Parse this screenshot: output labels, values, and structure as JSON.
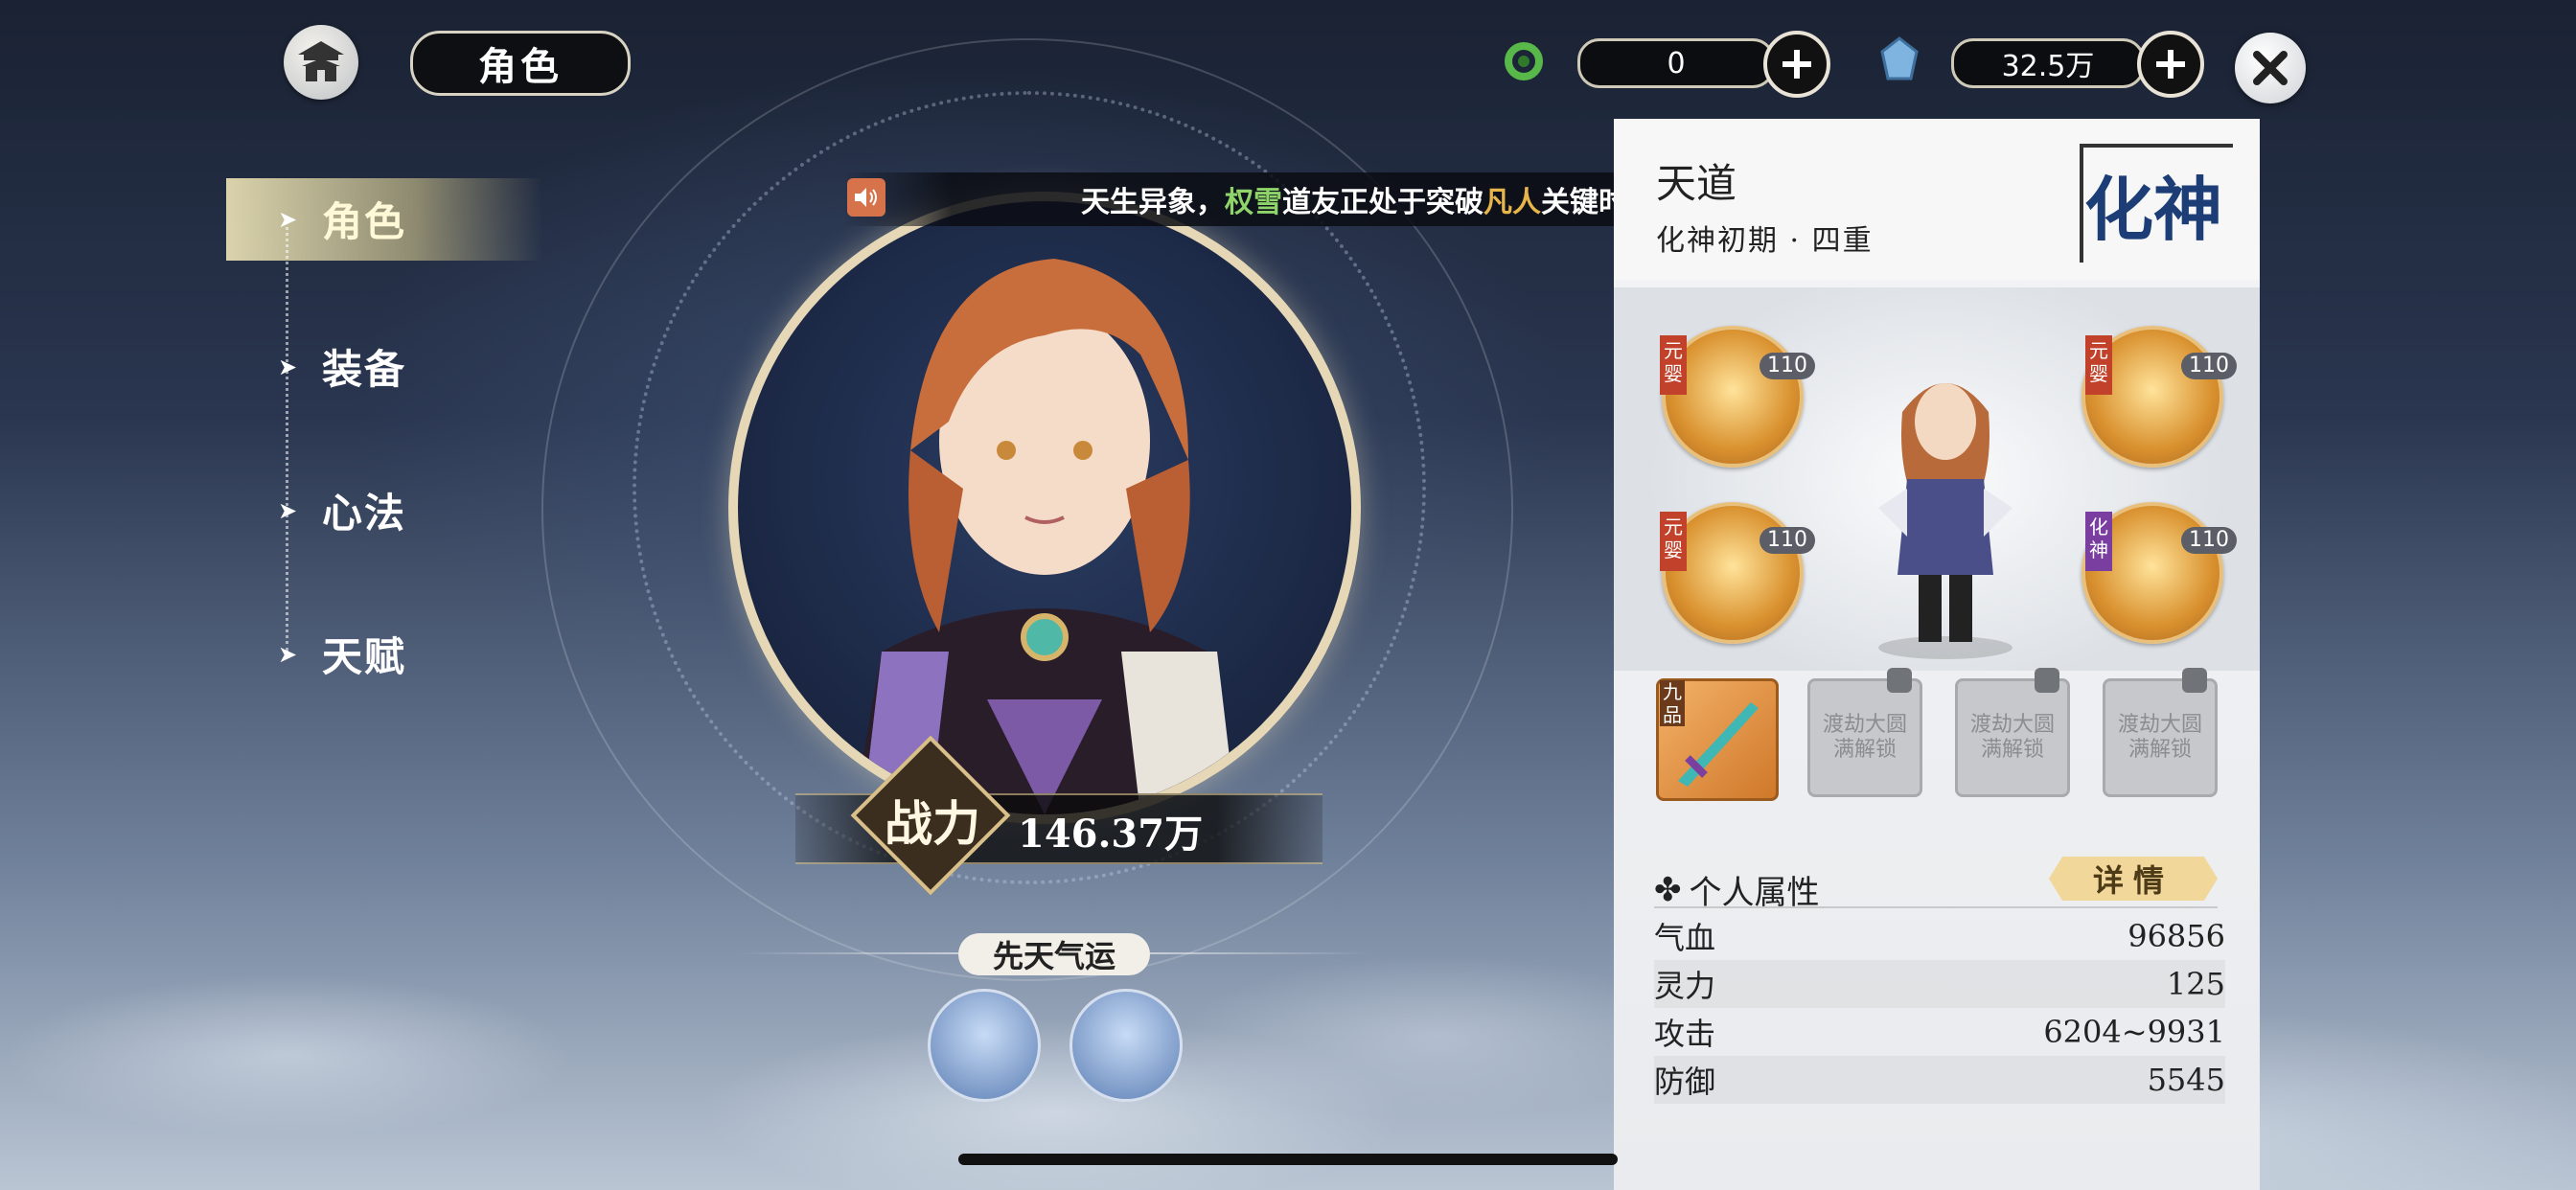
{
  "topbar": {
    "title": "角色",
    "currency1": {
      "icon": "jade-ring-icon",
      "value": "0"
    },
    "currency2": {
      "icon": "spirit-crystal-icon",
      "value": "32.5万"
    }
  },
  "nav": {
    "items": [
      {
        "label": "角色",
        "active": true
      },
      {
        "label": "装备",
        "active": false
      },
      {
        "label": "心法",
        "active": false
      },
      {
        "label": "天赋",
        "active": false
      }
    ]
  },
  "announcement": {
    "prefix": "天生异象，",
    "name": "权雪",
    "middle": "道友正处于突破",
    "realm": "凡人",
    "suffix": "关键时",
    "name_color": "#8fd46b",
    "realm_color": "#e7b54a"
  },
  "power": {
    "label": "战力",
    "value": "146.37万"
  },
  "fate": {
    "label": "先天气运"
  },
  "panel": {
    "realm_name": "天道",
    "realm_sub": "化神初期 · 四重",
    "realm_seal": "化神",
    "books": [
      {
        "tag": "元婴",
        "level": "110"
      },
      {
        "tag": "元婴",
        "level": "110"
      },
      {
        "tag": "元婴",
        "level": "110"
      },
      {
        "tag": "化神",
        "level": "110"
      }
    ],
    "weapon_tag": "九品",
    "locked_slot_text": [
      "渡劫大圆",
      "满解锁"
    ],
    "attr_title": "个人属性",
    "detail_button": "详情",
    "attributes": [
      {
        "name": "气血",
        "value": "96856"
      },
      {
        "name": "灵力",
        "value": "125"
      },
      {
        "name": "攻击",
        "value": "6204~9931"
      },
      {
        "name": "防御",
        "value": "5545"
      }
    ]
  },
  "colors": {
    "accent_gold": "#e6d8b6",
    "panel_bg": "#eef0f2"
  }
}
